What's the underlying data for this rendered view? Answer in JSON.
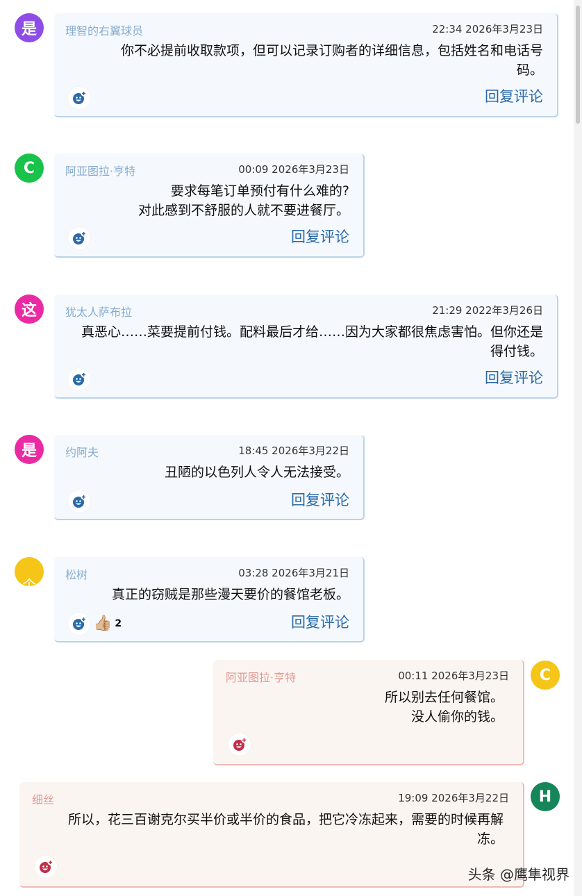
{
  "comments": [
    {
      "avatar_text": "是",
      "avatar_color": "#8f4de8",
      "author": "理智的右翼球员",
      "time": "22:34 2026年3月23日",
      "lines": [
        "你不必提前收取款项，但可以记录订购者的详细信息，包括姓名和电话号",
        "码。"
      ],
      "reply_label": "回复评论"
    },
    {
      "avatar_text": "C",
      "avatar_color": "#19c24a",
      "author": "阿亚图拉·亨特",
      "time": "00:09 2026年3月23日",
      "lines": [
        "要求每笔订单预付有什么难的?",
        "对此感到不舒服的人就不要进餐厅。"
      ],
      "reply_label": "回复评论"
    },
    {
      "avatar_text": "这",
      "avatar_color": "#ea2aa3",
      "author": "犹太人萨布拉",
      "time": "21:29 2022年3月26日",
      "lines": [
        "真恶心……菜要提前付钱。配料最后才给……因为大家都很焦虑害怕。但你还是",
        "得付钱。"
      ],
      "reply_label": "回复评论"
    },
    {
      "avatar_text": "是",
      "avatar_color": "#ea2aa3",
      "author": "约阿夫",
      "time": "18:45 2026年3月22日",
      "lines": [
        "丑陋的以色列人令人无法接受。"
      ],
      "reply_label": "回复评论"
    },
    {
      "avatar_text": "个",
      "avatar_color": "#f5c518",
      "author": "松树",
      "time": "03:28 2026年3月21日",
      "lines": [
        "真正的窃贼是那些漫天要价的餐馆老板。"
      ],
      "reply_label": "回复评论",
      "reaction_emoji": "👍🏼",
      "reaction_count": "2"
    },
    {
      "avatar_text": "C",
      "avatar_color": "#f5c518",
      "author": "阿亚图拉·亨特",
      "time": "00:11 2026年3月23日",
      "lines": [
        "所以别去任何餐馆。",
        "没人偷你的钱。"
      ]
    },
    {
      "avatar_text": "H",
      "avatar_color": "#17855a",
      "author": "细丝",
      "time": "19:09 2026年3月22日",
      "lines": [
        "所以，花三百谢克尔买半价或半价的食品，把它冷冻起来，需要的时候再解",
        "冻。"
      ]
    }
  ],
  "icons": {
    "react_blue": "#2a6aa8",
    "react_red": "#c0304a"
  },
  "watermark": "头条 @鹰隼视界"
}
